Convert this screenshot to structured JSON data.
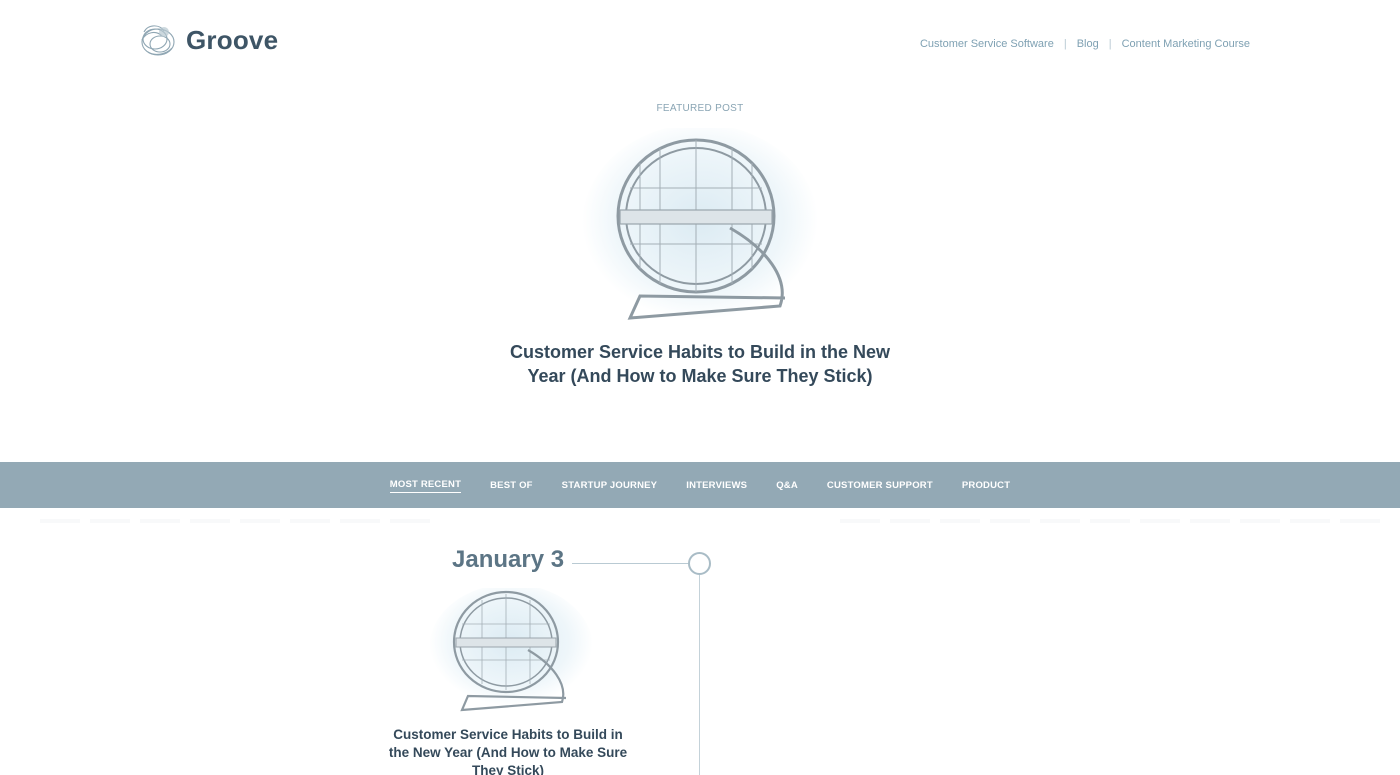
{
  "header": {
    "logo_text": "Groove",
    "nav": [
      {
        "label": "Customer Service Software"
      },
      {
        "label": "Blog"
      },
      {
        "label": "Content Marketing Course"
      }
    ],
    "separator": "|"
  },
  "featured": {
    "label": "FEATURED POST",
    "title": "Customer Service Habits to Build in the New Year (And How to Make Sure They Stick)",
    "image_icon": "hamster-wheel-icon"
  },
  "categories": [
    {
      "label": "MOST RECENT",
      "active": true
    },
    {
      "label": "BEST OF",
      "active": false
    },
    {
      "label": "STARTUP JOURNEY",
      "active": false
    },
    {
      "label": "INTERVIEWS",
      "active": false
    },
    {
      "label": "Q&A",
      "active": false
    },
    {
      "label": "CUSTOMER SUPPORT",
      "active": false
    },
    {
      "label": "PRODUCT",
      "active": false
    }
  ],
  "timeline": {
    "date": "January 3",
    "post_title": "Customer Service Habits to Build in the New Year (And How to Make Sure They Stick)",
    "image_icon": "hamster-wheel-icon"
  },
  "colors": {
    "category_bar": "#93a9b5",
    "link": "#7fa1b3",
    "heading": "#34495a"
  }
}
